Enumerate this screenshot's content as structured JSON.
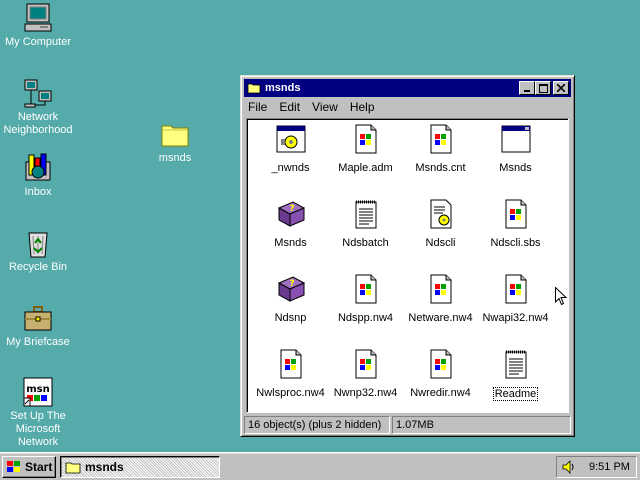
{
  "desktop": {
    "icons": [
      {
        "label": "My Computer",
        "icon": "my-computer-icon"
      },
      {
        "label": "Network Neighborhood",
        "icon": "network-icon"
      },
      {
        "label": "Inbox",
        "icon": "inbox-icon"
      },
      {
        "label": "Recycle Bin",
        "icon": "recycle-bin-icon"
      },
      {
        "label": "My Briefcase",
        "icon": "briefcase-icon"
      },
      {
        "label": "Set Up The Microsoft Network",
        "icon": "msn-icon"
      },
      {
        "label": "msnds",
        "icon": "folder-icon"
      }
    ]
  },
  "window": {
    "title": "msnds",
    "menu": [
      "File",
      "Edit",
      "View",
      "Help"
    ],
    "files": [
      {
        "label": "_nwnds",
        "icon": "app-window-gear-icon"
      },
      {
        "label": "Maple.adm",
        "icon": "windows-doc-icon"
      },
      {
        "label": "Msnds.cnt",
        "icon": "windows-doc-icon"
      },
      {
        "label": "Msnds",
        "icon": "app-window-icon"
      },
      {
        "label": "Msnds",
        "icon": "help-book-icon"
      },
      {
        "label": "Ndsbatch",
        "icon": "notepad-icon"
      },
      {
        "label": "Ndscli",
        "icon": "settings-file-icon"
      },
      {
        "label": "Ndscli.sbs",
        "icon": "windows-doc-icon"
      },
      {
        "label": "Ndsnp",
        "icon": "help-book-icon"
      },
      {
        "label": "Ndspp.nw4",
        "icon": "windows-doc-icon"
      },
      {
        "label": "Netware.nw4",
        "icon": "windows-doc-icon"
      },
      {
        "label": "Nwapi32.nw4",
        "icon": "windows-doc-icon"
      },
      {
        "label": "Nwlsproc.nw4",
        "icon": "windows-doc-icon"
      },
      {
        "label": "Nwnp32.nw4",
        "icon": "windows-doc-icon"
      },
      {
        "label": "Nwredir.nw4",
        "icon": "windows-doc-icon"
      },
      {
        "label": "Readme",
        "icon": "notepad-icon"
      }
    ],
    "status": {
      "objects": "16 object(s) (plus 2 hidden)",
      "size": "1.07MB"
    }
  },
  "taskbar": {
    "start_label": "Start",
    "task_label": "msnds",
    "clock": "9:51 PM"
  },
  "colors": {
    "desktop": "#55aaaa",
    "titlebar": "#000080",
    "chrome": "#c0c0c0"
  }
}
